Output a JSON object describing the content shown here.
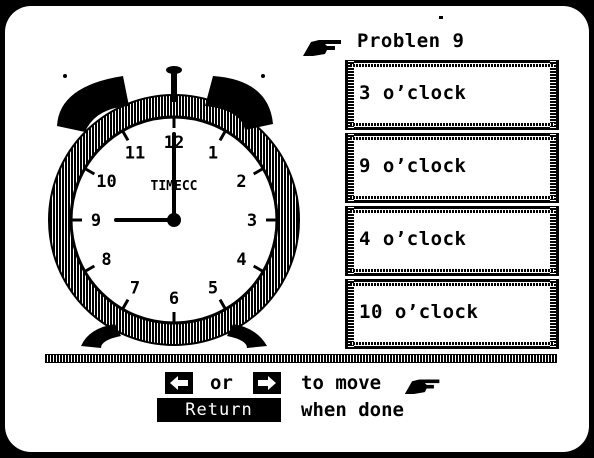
{
  "problem": {
    "label": "Problen 9"
  },
  "clock": {
    "brand": "TIMECC",
    "numbers": [
      "12",
      "1",
      "2",
      "3",
      "4",
      "5",
      "6",
      "7",
      "8",
      "9",
      "10",
      "11"
    ],
    "time_shown": {
      "hour": 9,
      "minute": 0
    }
  },
  "answers": [
    {
      "label": "3 o’clock"
    },
    {
      "label": "9 o’clock"
    },
    {
      "label": "4 o’clock"
    },
    {
      "label": "10 o’clock"
    }
  ],
  "instructions": {
    "or_label": "or",
    "move_label": "to move",
    "return_key": "Return",
    "done_label": "when done"
  },
  "icons": {
    "pointer": "pointing-hand-icon",
    "left_arrow": "left-arrow-key-icon",
    "right_arrow": "right-arrow-key-icon"
  },
  "colors": {
    "foreground": "#000000",
    "background": "#ffffff",
    "bezel": "#000000"
  }
}
